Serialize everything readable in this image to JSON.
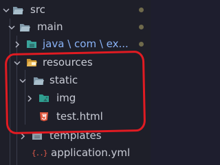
{
  "tree": {
    "items": [
      {
        "label": "src",
        "type": "folder",
        "expanded": true
      },
      {
        "label": "main",
        "type": "folder",
        "expanded": true
      },
      {
        "label": "java \\ com \\ ex...",
        "type": "folder",
        "expanded": false
      },
      {
        "label": "resources",
        "type": "folder",
        "expanded": true
      },
      {
        "label": "static",
        "type": "folder",
        "expanded": true
      },
      {
        "label": "img",
        "type": "folder",
        "expanded": false
      },
      {
        "label": "test.html",
        "type": "file",
        "file_icon": "html5-icon"
      },
      {
        "label": "templates",
        "type": "folder",
        "expanded": false
      },
      {
        "label": "application.yml",
        "type": "file",
        "file_icon": "yaml-braces-icon"
      }
    ]
  },
  "colors": {
    "background": "#1e1f29",
    "folder": "#8fa6b6",
    "resources_folder": "#d9a84a",
    "html_icon": "#e2583e",
    "yaml_icon": "#e25b4b",
    "highlight": "#e11b22",
    "modified_dot": "#6f6a4b"
  }
}
